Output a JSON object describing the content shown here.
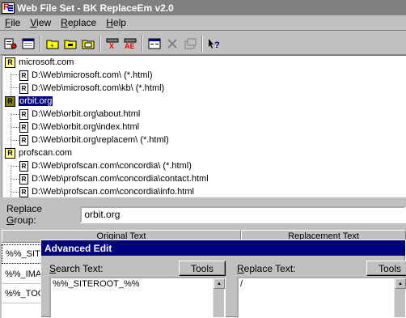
{
  "window": {
    "title": "Web File Set - BK ReplaceEm v2.0"
  },
  "menu": [
    {
      "label": "File",
      "ul": "F",
      "rest": "ile"
    },
    {
      "label": "View",
      "ul": "V",
      "rest": "iew"
    },
    {
      "label": "Replace",
      "ul": "R",
      "rest": "eplace"
    },
    {
      "label": "Help",
      "ul": "H",
      "rest": "elp"
    }
  ],
  "toolbar": {
    "icons": [
      "new-file-set-icon",
      "open-icon",
      "add-group-icon",
      "add-folder-icon",
      "add-file-icon",
      "find-icon",
      "replace-all-icon",
      "advanced-edit-icon",
      "delete-icon",
      "properties-icon",
      "context-help-icon"
    ]
  },
  "tree": {
    "groups": [
      {
        "name": "microsoft.com",
        "selected": false,
        "files": [
          "D:\\Web\\microsoft.com\\ (*.html)",
          "D:\\Web\\microsoft.com\\kb\\ (*.html)"
        ]
      },
      {
        "name": "orbit.org",
        "selected": true,
        "files": [
          "D:\\Web\\orbit.org\\about.html",
          "D:\\Web\\orbit.org\\index.html",
          "D:\\Web\\orbit.org\\replacem\\ (*.html)"
        ]
      },
      {
        "name": "profscan.com",
        "selected": false,
        "files": [
          "D:\\Web\\profscan.com\\concordia\\ (*.html)",
          "D:\\Web\\profscan.com\\concordia\\contact.html",
          "D:\\Web\\profscan.com\\concordia\\info.html"
        ]
      }
    ]
  },
  "replace_group": {
    "label": "Replace Group:",
    "label_ul": "G",
    "value": "orbit.org"
  },
  "table": {
    "headers": [
      "Original Text",
      "Replacement Text"
    ],
    "rows": [
      "%%_SITEROOT_%%",
      "%%_IMAGES_%%",
      "%%_TOOLS_%%"
    ]
  },
  "advanced_edit": {
    "title": "Advanced Edit",
    "search_label": "Search Text:",
    "search_ul": "S",
    "search_value": "%%_SITEROOT_%%",
    "replace_label": "Replace Text:",
    "replace_ul": "R",
    "replace_value": "/",
    "tools_label": "Tools"
  }
}
